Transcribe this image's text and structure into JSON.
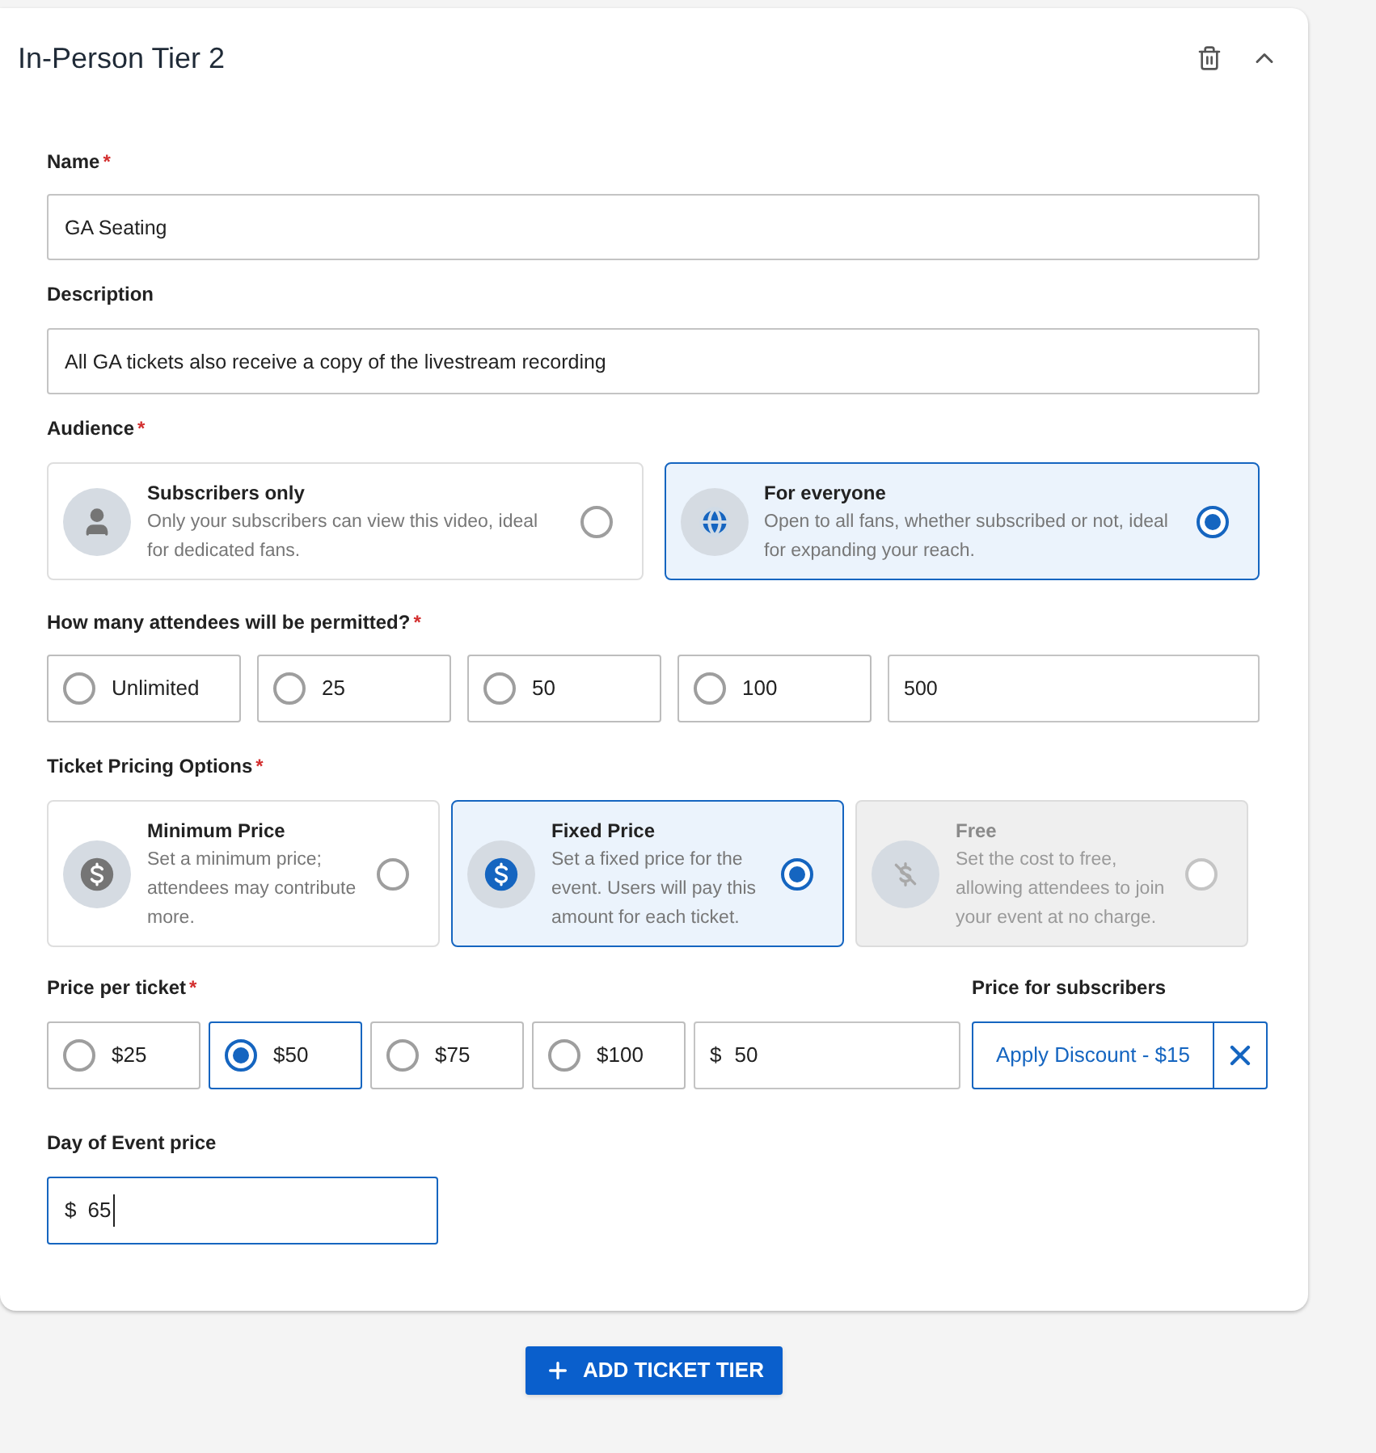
{
  "card": {
    "title": "In-Person Tier 2",
    "expanded": true
  },
  "name": {
    "label": "Name",
    "required_mark": "*",
    "value": "GA Seating"
  },
  "description": {
    "label": "Description",
    "value": "All GA tickets also receive a copy of the livestream recording"
  },
  "audience": {
    "label": "Audience",
    "required_mark": "*",
    "options": [
      {
        "kind": "person",
        "title": "Subscribers only",
        "text": "Only your subscribers can view this video, ideal for dedicated fans.",
        "selected": false
      },
      {
        "kind": "globe",
        "title": "For everyone",
        "text": "Open to all fans, whether subscribed or not, ideal for expanding your reach.",
        "selected": true
      }
    ]
  },
  "attendees": {
    "label": "How many attendees will be permitted?",
    "required_mark": "*",
    "options": [
      {
        "label": "Unlimited",
        "selected": false
      },
      {
        "label": "25",
        "selected": false
      },
      {
        "label": "50",
        "selected": false
      },
      {
        "label": "100",
        "selected": false
      }
    ],
    "custom_value": "500"
  },
  "pricing": {
    "label": "Ticket Pricing Options",
    "required_mark": "*",
    "options": [
      {
        "kind": "dollar",
        "title": "Minimum Price",
        "text": "Set a minimum price; attendees may contribute more.",
        "selected": false,
        "disabled": false
      },
      {
        "kind": "dollar",
        "title": "Fixed Price",
        "text": "Set a fixed price for the event. Users will pay this amount for each ticket.",
        "selected": true,
        "disabled": false
      },
      {
        "kind": "no-dollar",
        "title": "Free",
        "text": "Set the cost to free, allowing attendees to join your event at no charge.",
        "selected": false,
        "disabled": true
      }
    ]
  },
  "price": {
    "label": "Price per ticket",
    "required_mark": "*",
    "options": [
      {
        "label": "$25",
        "selected": false
      },
      {
        "label": "$50",
        "selected": true
      },
      {
        "label": "$75",
        "selected": false
      },
      {
        "label": "$100",
        "selected": false
      }
    ],
    "custom_prefix": "$",
    "custom_value": "50"
  },
  "subscribers": {
    "label": "Price for subscribers",
    "button": "Apply Discount - $15"
  },
  "day_of_event": {
    "label": "Day of Event price",
    "prefix": "$",
    "value": "65",
    "focused": true
  },
  "add_button": {
    "label": "ADD TICKET TIER"
  }
}
